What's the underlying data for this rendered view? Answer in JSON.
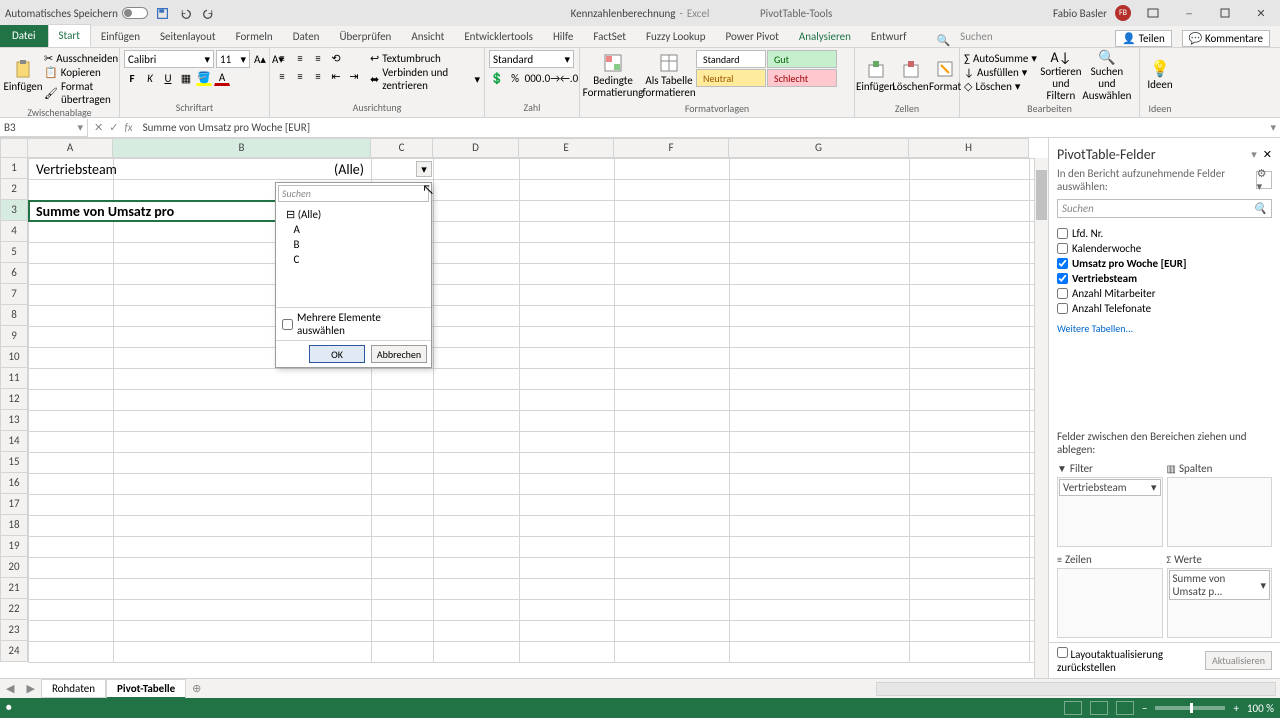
{
  "titlebar": {
    "autosave": "Automatisches Speichern",
    "doc": "Kennzahlenberechnung",
    "app": "Excel",
    "tools": "PivotTable-Tools",
    "user": "Fabio Basler",
    "initials": "FB"
  },
  "tabs": {
    "file": "Datei",
    "start": "Start",
    "einfuegen": "Einfügen",
    "seitenlayout": "Seitenlayout",
    "formeln": "Formeln",
    "daten": "Daten",
    "ueberpruefen": "Überprüfen",
    "ansicht": "Ansicht",
    "entwickler": "Entwicklertools",
    "hilfe": "Hilfe",
    "factset": "FactSet",
    "fuzzy": "Fuzzy Lookup",
    "powerpivot": "Power Pivot",
    "analysieren": "Analysieren",
    "entwurf": "Entwurf",
    "suchen": "Suchen",
    "teilen": "Teilen",
    "kommentare": "Kommentare"
  },
  "ribbon": {
    "einfuegen": "Einfügen",
    "ausschneiden": "Ausschneiden",
    "kopieren": "Kopieren",
    "format_ueb": "Format übertragen",
    "zwischenablage": "Zwischenablage",
    "font_name": "Calibri",
    "font_size": "11",
    "schriftart": "Schriftart",
    "textumbruch": "Textumbruch",
    "verbinden": "Verbinden und zentrieren",
    "ausrichtung": "Ausrichtung",
    "zahlformat": "Standard",
    "zahl": "Zahl",
    "bedingte": "Bedingte Formatierung",
    "alstabelle": "Als Tabelle formatieren",
    "s_standard": "Standard",
    "s_gut": "Gut",
    "s_neutral": "Neutral",
    "s_schlecht": "Schlecht",
    "formatvorlagen": "Formatvorlagen",
    "z_einfuegen": "Einfügen",
    "z_loeschen": "Löschen",
    "z_format": "Format",
    "zellen": "Zellen",
    "autosumme": "AutoSumme",
    "ausfuellen": "Ausfüllen",
    "loeschen": "Löschen",
    "sortfilter": "Sortieren und Filtern",
    "suchenausw": "Suchen und Auswählen",
    "bearbeiten": "Bearbeiten",
    "ideen": "Ideen"
  },
  "formula": {
    "namebox": "B3",
    "content": "Summe von Umsatz pro Woche [EUR]"
  },
  "cols": [
    "A",
    "B",
    "C",
    "D",
    "E",
    "F",
    "G",
    "H"
  ],
  "rows": [
    1,
    2,
    3,
    4,
    5,
    6,
    7,
    8,
    9,
    10,
    11,
    12,
    13,
    14,
    15,
    16,
    17,
    18,
    19,
    20,
    21,
    22,
    23,
    24
  ],
  "cells": {
    "b1": "Vertriebsteam",
    "c1": "(Alle)",
    "b3": "Summe von Umsatz pro"
  },
  "filterdrop": {
    "search": "Suchen",
    "items": [
      "(Alle)",
      "A",
      "B",
      "C"
    ],
    "multi": "Mehrere Elemente auswählen",
    "ok": "OK",
    "cancel": "Abbrechen"
  },
  "pane": {
    "title": "PivotTable-Felder",
    "desc": "In den Bericht aufzunehmende Felder auswählen:",
    "search": "Suchen",
    "fields": [
      {
        "label": "Lfd. Nr.",
        "checked": false
      },
      {
        "label": "Kalenderwoche",
        "checked": false
      },
      {
        "label": "Umsatz pro Woche [EUR]",
        "checked": true,
        "bold": true
      },
      {
        "label": "Vertriebsteam",
        "checked": true,
        "bold": true
      },
      {
        "label": "Anzahl Mitarbeiter",
        "checked": false
      },
      {
        "label": "Anzahl Telefonate",
        "checked": false
      }
    ],
    "weitere": "Weitere Tabellen...",
    "dragdesc": "Felder zwischen den Bereichen ziehen und ablegen:",
    "areas": {
      "filter": "Filter",
      "spalten": "Spalten",
      "zeilen": "Zeilen",
      "werte": "Werte"
    },
    "filter_item": "Vertriebsteam",
    "werte_item": "Summe von Umsatz p...",
    "defer": "Layoutaktualisierung zurückstellen",
    "update": "Aktualisieren"
  },
  "sheets": {
    "rohdaten": "Rohdaten",
    "pivot": "Pivot-Tabelle"
  },
  "status": {
    "zoom": "100 %"
  }
}
